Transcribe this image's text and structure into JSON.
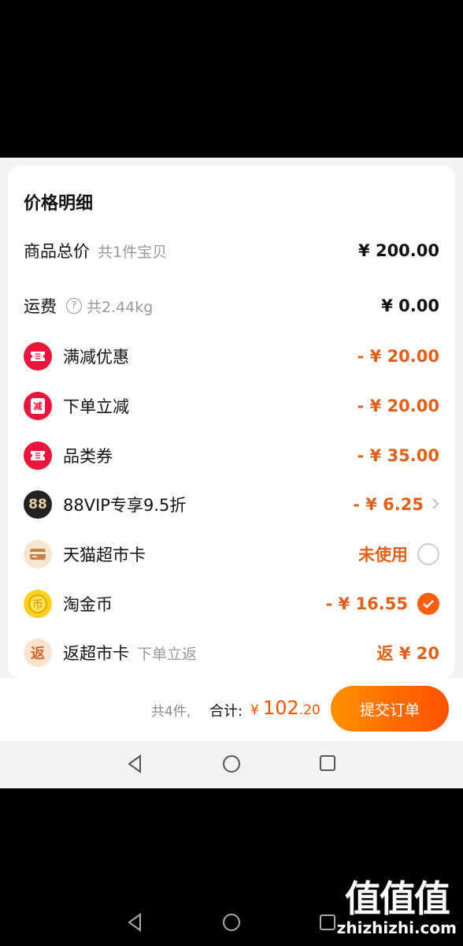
{
  "panel": {
    "title": "价格明细"
  },
  "rows": {
    "goods": {
      "label": "商品总价",
      "sub": "共1件宝贝",
      "value": "¥ 200.00"
    },
    "shipping": {
      "label": "运费",
      "help": "?",
      "sub": "共2.44kg",
      "value": "¥ 0.00"
    },
    "full_reduction": {
      "label": "满减优惠",
      "value": "- ¥ 20.00",
      "icon": "ticket-icon"
    },
    "order_discount": {
      "label": "下单立减",
      "icon_text": "减",
      "value": "- ¥ 20.00",
      "icon": "discount-tag-icon"
    },
    "category_coupon": {
      "label": "品类券",
      "value": "- ¥ 35.00",
      "icon": "ticket-icon"
    },
    "vip": {
      "label": "88VIP专享9.5折",
      "icon_text": "88",
      "value": "- ¥ 6.25",
      "icon": "vip88-icon"
    },
    "market_card": {
      "label": "天猫超市卡",
      "value": "未使用",
      "icon": "card-icon",
      "selected": false
    },
    "coins": {
      "label": "淘金币",
      "value": "- ¥ 16.55",
      "icon": "coin-icon",
      "selected": true
    },
    "rebate": {
      "label": "返超市卡",
      "icon_text": "返",
      "sub": "下单立返",
      "value": "返 ¥ 20",
      "icon": "rebate-icon"
    }
  },
  "footer": {
    "count": "共4件,",
    "total_label": "合计:",
    "yen": "¥",
    "total_int": "102",
    "total_dec": ".20",
    "submit_label": "提交订单"
  },
  "watermark": {
    "big": "值值值",
    "small": "zhizhizhi.com"
  },
  "colors": {
    "accent": "#e0601a",
    "button_start": "#ff9000",
    "button_end": "#ff5000",
    "red_icon": "#e8163a"
  }
}
